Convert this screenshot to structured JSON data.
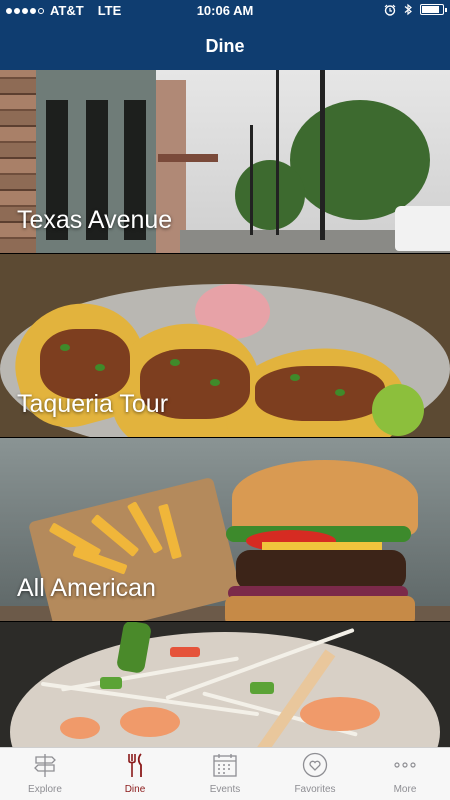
{
  "status_bar": {
    "carrier": "AT&T",
    "network": "LTE",
    "time": "10:06 AM",
    "signal_strength": 4,
    "signal_max": 5,
    "battery_level": 0.85
  },
  "header": {
    "title": "Dine"
  },
  "cards": [
    {
      "label": "Texas Avenue"
    },
    {
      "label": "Taqueria Tour"
    },
    {
      "label": "All American"
    },
    {
      "label": ""
    }
  ],
  "tabs": [
    {
      "label": "Explore",
      "icon": "signpost-icon",
      "active": false
    },
    {
      "label": "Dine",
      "icon": "fork-knife-icon",
      "active": true
    },
    {
      "label": "Events",
      "icon": "calendar-icon",
      "active": false
    },
    {
      "label": "Favorites",
      "icon": "heart-icon",
      "active": false
    },
    {
      "label": "More",
      "icon": "ellipsis-icon",
      "active": false
    }
  ],
  "colors": {
    "header_bg": "#0f3d70",
    "tab_active": "#8b1a1a",
    "tab_inactive": "#8e8e93"
  }
}
